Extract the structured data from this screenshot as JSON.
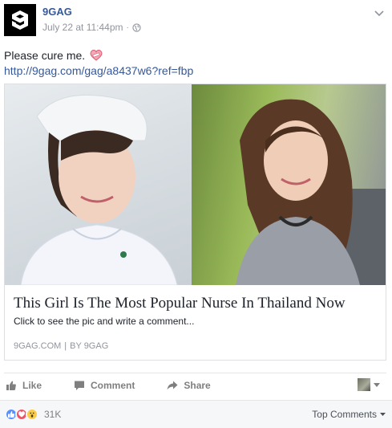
{
  "post": {
    "page_name": "9GAG",
    "timestamp": "July 22 at 11:44pm",
    "separator": "·",
    "avatar_icon": "9gag-logo-icon",
    "text": "Please cure me.",
    "emoji": "heart-bandaged-icon",
    "link": "http://9gag.com/gag/a8437w6?ref=fbp"
  },
  "share": {
    "image_left": "nurse-photo",
    "image_right": "portrait-photo",
    "title": "This Girl Is The Most Popular Nurse In Thailand Now",
    "description": "Click to see the pic and write a comment...",
    "domain": "9GAG.COM",
    "separator": "|",
    "author": "BY 9GAG"
  },
  "actions": {
    "like": "Like",
    "comment": "Comment",
    "share": "Share"
  },
  "footer": {
    "reaction_count": "31K",
    "top_comments": "Top Comments"
  },
  "colors": {
    "link": "#365899",
    "meta": "#90949c",
    "like_blue": "#5890ff",
    "love_red": "#f25268",
    "wow_yellow": "#fbcd45"
  }
}
